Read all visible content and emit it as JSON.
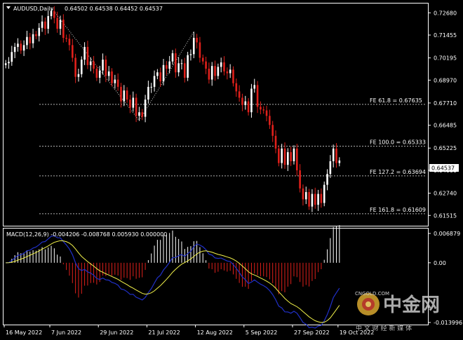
{
  "symbol": "AUDUSD,Daily",
  "ohlc": "0.64502 0.64538 0.64452 0.64537",
  "current_price_label": "0.64537",
  "price_axis": [
    "0.72680",
    "0.71455",
    "0.70195",
    "0.68970",
    "0.67710",
    "0.66485",
    "0.65225",
    "0.64000",
    "0.62740",
    "0.61515"
  ],
  "date_axis": [
    "16 May 2022",
    "7 Jun 2022",
    "29 Jun 2022",
    "21 Jul 2022",
    "12 Aug 2022",
    "5 Sep 2022",
    "27 Sep 2022",
    "19 Oct 2022"
  ],
  "fibo_levels": [
    {
      "label": "FE 61.8 = 0.67635",
      "price": 0.67635
    },
    {
      "label": "FE 100.0 = 0.65333",
      "price": 0.65333
    },
    {
      "label": "FE 127.2 = 0.63694",
      "price": 0.63694
    },
    {
      "label": "FE 161.8 = 0.61609",
      "price": 0.61609
    }
  ],
  "macd": {
    "title": "MACD(12,26,9) -0.004206 -0.008768 0.005930 0.000000",
    "axis": [
      "0.006879",
      "0.00",
      "-0.013996"
    ]
  },
  "watermark": {
    "brand": "中金网",
    "sub": "中 文 财 经 新 媒 体",
    "site": "CNGOLD.COM"
  },
  "colors": {
    "bull": "#ffffff",
    "bear": "#e0201b",
    "signal": "#f2f24a",
    "macd_line": "#2030c8",
    "fibo": "#b0b0b0"
  },
  "chart_data": {
    "type": "candlestick",
    "ylim": [
      0.611,
      0.73
    ],
    "close": [
      0.699,
      0.6998,
      0.7052,
      0.708,
      0.7098,
      0.706,
      0.709,
      0.7135,
      0.71,
      0.715,
      0.714,
      0.7185,
      0.722,
      0.718,
      0.725,
      0.7278,
      0.724,
      0.718,
      0.723,
      0.713,
      0.7125,
      0.709,
      0.702,
      0.6915,
      0.693,
      0.701,
      0.708,
      0.698,
      0.7,
      0.696,
      0.691,
      0.695,
      0.701,
      0.692,
      0.6945,
      0.688,
      0.69,
      0.686,
      0.678,
      0.684,
      0.679,
      0.6745,
      0.68,
      0.67,
      0.672,
      0.6695,
      0.679,
      0.686,
      0.686,
      0.692,
      0.694,
      0.689,
      0.698,
      0.696,
      0.7,
      0.7045,
      0.694,
      0.699,
      0.699,
      0.691,
      0.7035,
      0.704,
      0.713,
      0.7105,
      0.702,
      0.7,
      0.696,
      0.69,
      0.6975,
      0.692,
      0.697,
      0.6995,
      0.6945,
      0.6935,
      0.6955,
      0.688,
      0.6835,
      0.68,
      0.676,
      0.678,
      0.672,
      0.685,
      0.687,
      0.675,
      0.6735,
      0.673,
      0.67,
      0.665,
      0.659,
      0.652,
      0.644,
      0.652,
      0.643,
      0.65,
      0.645,
      0.652,
      0.64,
      0.63,
      0.624,
      0.628,
      0.62,
      0.627,
      0.621,
      0.627,
      0.622,
      0.632,
      0.638,
      0.645,
      0.652,
      0.644,
      0.6454
    ],
    "macd": {
      "axis_range": [
        -0.013996,
        0.006879
      ]
    }
  }
}
